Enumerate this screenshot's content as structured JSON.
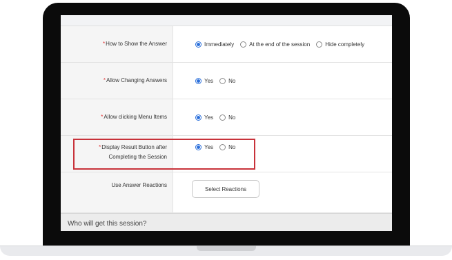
{
  "settings": {
    "rows": [
      {
        "label": "How to Show the Answer",
        "required": true,
        "options": [
          "Immediately",
          "At the end of the session",
          "Hide completely"
        ],
        "selected": "Immediately"
      },
      {
        "label": "Allow Changing Answers",
        "required": true,
        "options": [
          "Yes",
          "No"
        ],
        "selected": "Yes"
      },
      {
        "label": "Allow clicking Menu Items",
        "required": true,
        "options": [
          "Yes",
          "No"
        ],
        "selected": "Yes"
      },
      {
        "label_line1": "Display Result Button after",
        "label_line2": "Completing the Session",
        "required": true,
        "options": [
          "Yes",
          "No"
        ],
        "selected": "Yes"
      },
      {
        "label": "Use Answer Reactions",
        "required": false,
        "button_label": "Select Reactions"
      }
    ],
    "required_mark": "*"
  },
  "section_footer": {
    "title": "Who will get this session?"
  },
  "colors": {
    "radio_selected": "#2a6fdb",
    "required_mark": "#e03030",
    "highlight_border": "#c8323a"
  }
}
